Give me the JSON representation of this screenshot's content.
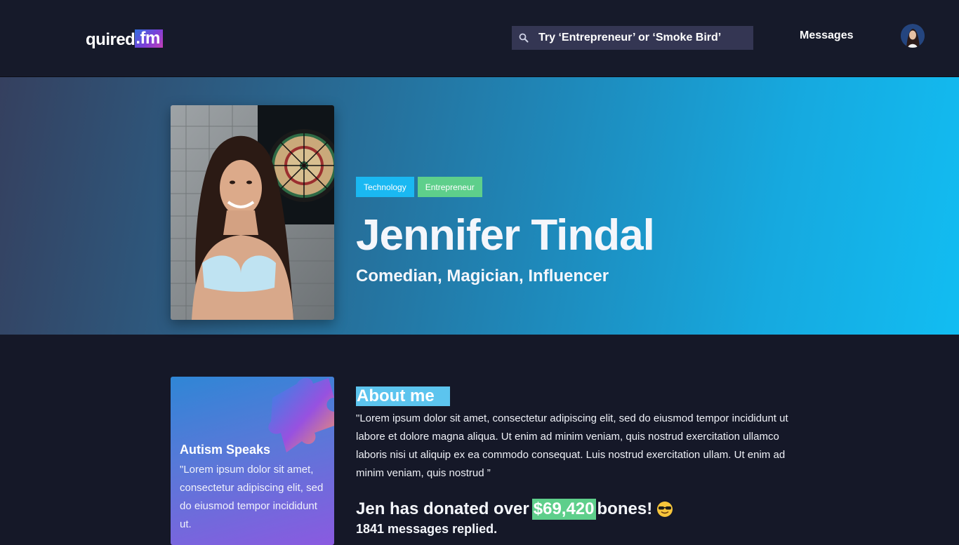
{
  "header": {
    "logo": {
      "main": "quired",
      "tld": ".fm"
    },
    "search": {
      "placeholder": "Try ‘Entrepreneur’ or ‘Smoke Bird’",
      "icon": "search-icon"
    },
    "messages_label": "Messages",
    "avatar_icon": "user-avatar"
  },
  "profile": {
    "tags": [
      "Technology",
      "Entrepreneur"
    ],
    "name": "Jennifer Tindal",
    "roles": "Comedian, Magician, Influencer",
    "portrait_icon": "profile-photo"
  },
  "charity": {
    "title": "Autism Speaks",
    "text": "\"Lorem ipsum dolor sit amet, consectetur adipiscing elit, sed do eiusmod tempor incididunt ut.",
    "icon": "puzzle-piece-icon"
  },
  "about": {
    "title": "About me",
    "text": "\"Lorem ipsum dolor sit amet, consectetur adipiscing elit, sed do eiusmod tempor incididunt ut labore et dolore magna aliqua. Ut enim ad minim veniam, quis nostrud exercitation ullamco laboris nisi ut aliquip ex ea commodo consequat.  Luis nostrud exercitation ullam.  Ut enim ad minim veniam, quis nostrud ”"
  },
  "stats": {
    "donation_prefix": "Jen has donated over",
    "donation_amount": "$69,420",
    "donation_suffix": "bones!",
    "emoji_icon": "sunglasses-emoji-icon",
    "replies": "1841 messages replied."
  },
  "colors": {
    "background": "#151828",
    "topbar": "#161a2a",
    "search_bg": "#343653",
    "tag_technology": "#1ab8f2",
    "tag_entrepreneur": "#5ecf8b",
    "about_highlight": "#5cc4ee",
    "amount_highlight": "#5ecf8b"
  }
}
